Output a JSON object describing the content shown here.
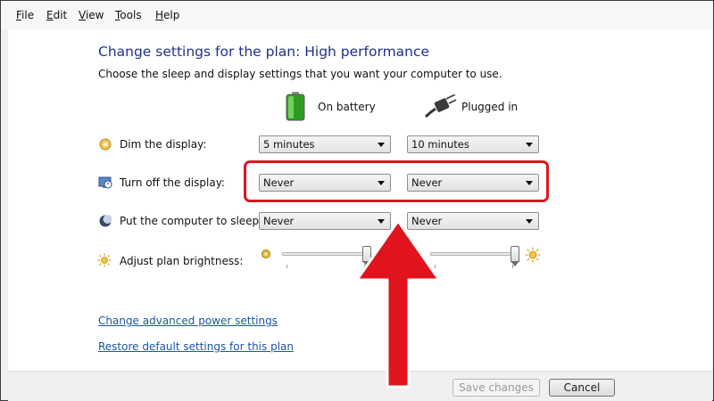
{
  "menu": {
    "items": [
      {
        "key": "F",
        "rest": "ile"
      },
      {
        "key": "E",
        "rest": "dit"
      },
      {
        "key": "V",
        "rest": "iew"
      },
      {
        "key": "T",
        "rest": "ools"
      },
      {
        "key": "H",
        "rest": "elp"
      }
    ]
  },
  "page": {
    "title": "Change settings for the plan: High performance",
    "subtitle": "Choose the sleep and display settings that you want your computer to use."
  },
  "columns": {
    "on_battery": "On battery",
    "plugged_in": "Plugged in"
  },
  "rows": {
    "dim": {
      "label": "Dim the display:",
      "battery": "5 minutes",
      "plugged": "10 minutes"
    },
    "turn_off": {
      "label": "Turn off the display:",
      "battery": "Never",
      "plugged": "Never"
    },
    "sleep": {
      "label": "Put the computer to sleep:",
      "battery": "Never",
      "plugged": "Never"
    },
    "brightness": {
      "label": "Adjust plan brightness:",
      "battery_level": 0.95,
      "plugged_level": 0.95
    }
  },
  "links": {
    "advanced": "Change advanced power settings",
    "restore": "Restore default settings for this plan"
  },
  "buttons": {
    "save": "Save changes",
    "cancel": "Cancel"
  },
  "colors": {
    "title": "#1e3287",
    "link": "#1a56a8",
    "highlight": "#e1141e",
    "battery_green": "#3dbb2a"
  },
  "icons": {
    "battery": "battery-icon",
    "plug": "plug-icon",
    "dim": "dim-display-icon",
    "display": "monitor-clock-icon",
    "sleep": "moon-icon",
    "brightness": "sun-icon"
  }
}
